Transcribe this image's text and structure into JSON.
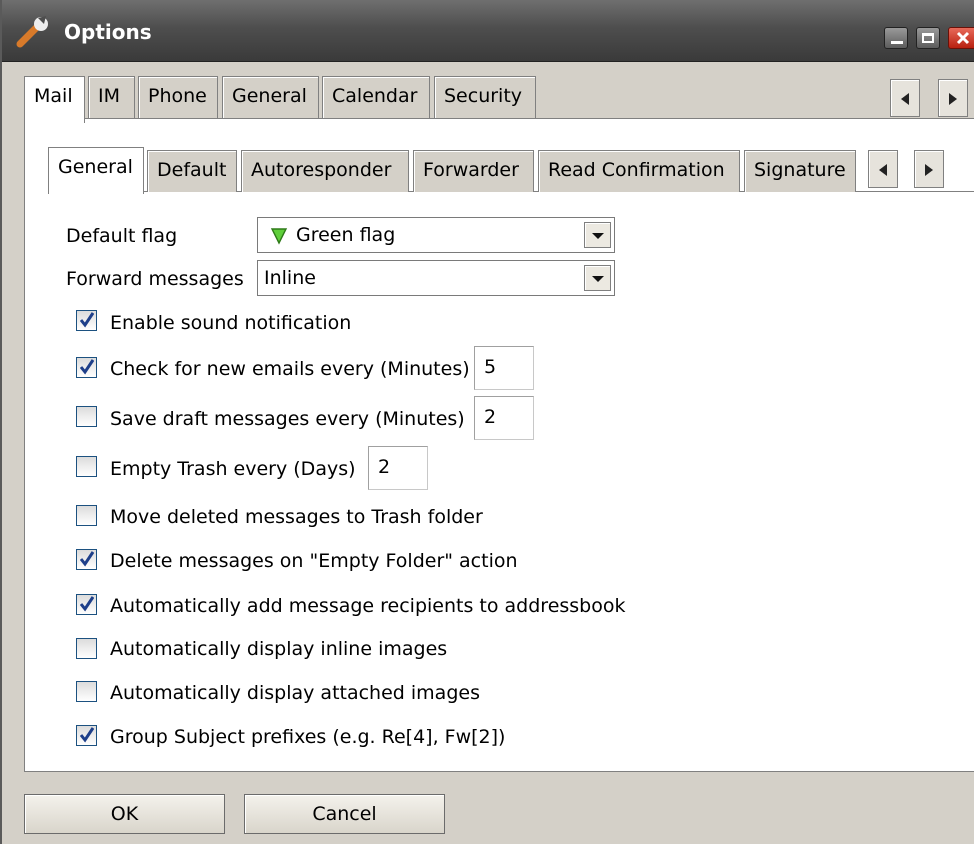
{
  "window": {
    "title": "Options"
  },
  "main_tabs": [
    "Mail",
    "IM",
    "Phone",
    "General",
    "Calendar",
    "Security"
  ],
  "sub_tabs": [
    "General",
    "Default",
    "Autoresponder",
    "Forwarder",
    "Read Confirmation",
    "Signature"
  ],
  "form": {
    "default_flag_label": "Default flag",
    "default_flag_value": "Green flag",
    "forward_messages_label": "Forward messages",
    "forward_messages_value": "Inline"
  },
  "options": [
    {
      "label": "Enable sound notification",
      "checked": true
    },
    {
      "label": "Check for new emails every (Minutes)",
      "checked": true,
      "value": "5"
    },
    {
      "label": "Save draft messages every (Minutes)",
      "checked": false,
      "value": "2"
    },
    {
      "label": "Empty Trash every (Days)",
      "checked": false,
      "value": "2"
    },
    {
      "label": "Move deleted messages to Trash folder",
      "checked": false
    },
    {
      "label": "Delete messages on \"Empty Folder\" action",
      "checked": true
    },
    {
      "label": "Automatically add message recipients to addressbook",
      "checked": true
    },
    {
      "label": "Automatically display inline images",
      "checked": false
    },
    {
      "label": "Automatically display attached images",
      "checked": false
    },
    {
      "label": "Group Subject prefixes (e.g. Re[4], Fw[2])",
      "checked": true
    }
  ],
  "buttons": {
    "ok": "OK",
    "cancel": "Cancel"
  },
  "colors": {
    "flag": "#5fcf3a",
    "check": "#1e3f8a"
  }
}
